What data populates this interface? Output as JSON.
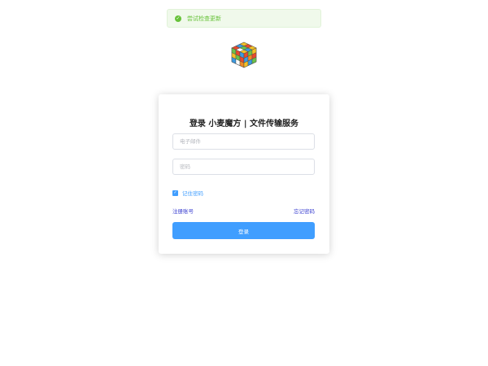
{
  "toast": {
    "message": "尝试检查更新",
    "status_color": "#67c23a"
  },
  "logo": {
    "icon": "rubiks-cube-icon"
  },
  "login": {
    "title": "登录 小麦魔方 | 文件传输服务",
    "email_placeholder": "电子邮件",
    "email_value": "",
    "password_placeholder": "密码",
    "password_value": "",
    "remember_label": "记住密码",
    "remember_checked": true,
    "register_link": "注册账号",
    "forgot_link": "忘记密码",
    "submit_label": "登录"
  },
  "colors": {
    "accent": "#409eff",
    "link": "#3a3fd0"
  }
}
